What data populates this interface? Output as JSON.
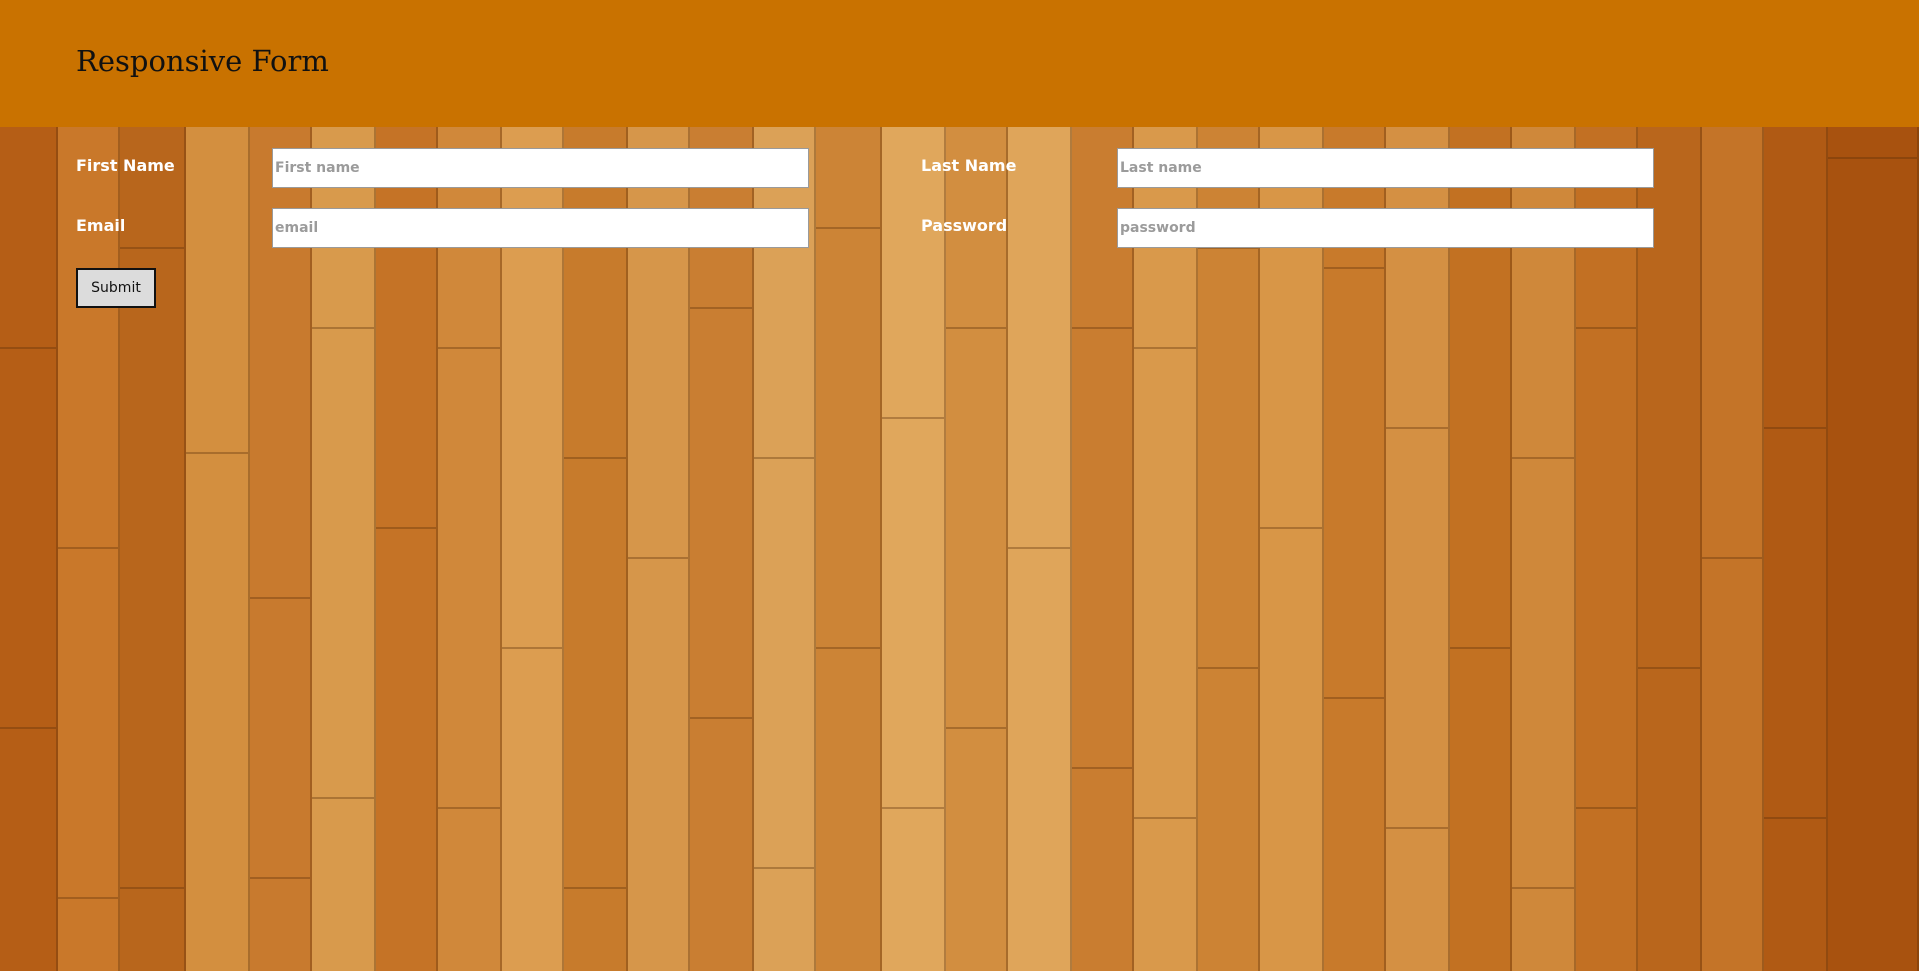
{
  "header": {
    "title": "Responsive Form"
  },
  "form": {
    "first_name": {
      "label": "First Name",
      "placeholder": "First name",
      "value": ""
    },
    "last_name": {
      "label": "Last Name",
      "placeholder": "Last name",
      "value": ""
    },
    "email": {
      "label": "Email",
      "placeholder": "email",
      "value": ""
    },
    "password": {
      "label": "Password",
      "placeholder": "password",
      "value": ""
    },
    "submit_label": "Submit"
  },
  "colors": {
    "header_background": "#c97200",
    "wood_background": "#cf8a38",
    "label_text": "#ffffff",
    "title_text": "#111111"
  }
}
